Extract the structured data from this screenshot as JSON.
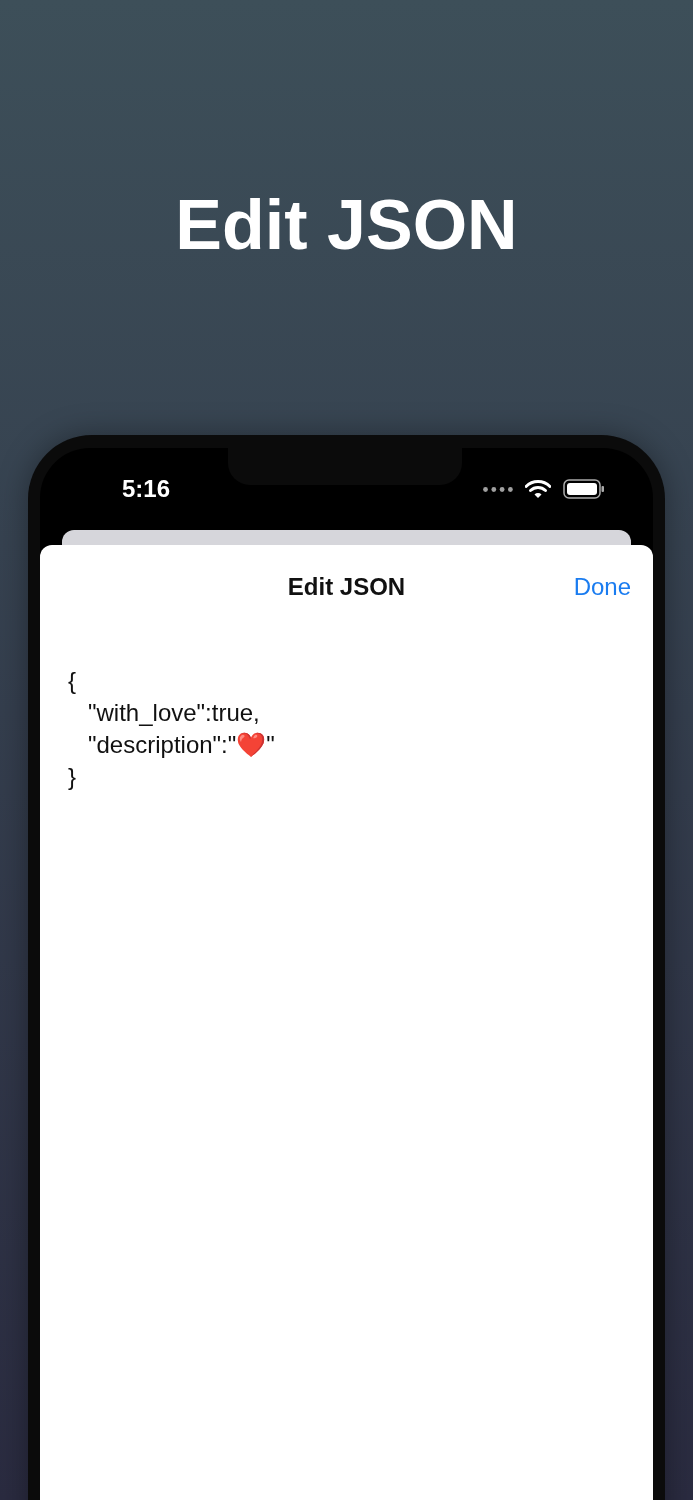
{
  "headline": "Edit JSON",
  "status_bar": {
    "time": "5:16"
  },
  "nav": {
    "title": "Edit JSON",
    "done": "Done"
  },
  "editor": {
    "value": "{\n   \"with_love\":true,\n   \"description\":\"❤️\"\n}"
  }
}
